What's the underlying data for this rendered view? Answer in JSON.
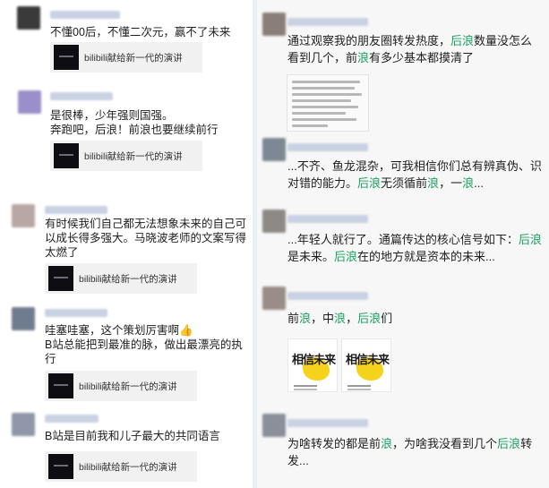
{
  "left_comments": [
    {
      "text": "不懂00后，不懂二次元，赢不了未来",
      "card": "bilibili献给新一代的演讲",
      "avatar_color": "#3a3a3a"
    },
    {
      "text": "是很棒，少年强则国强。\n奔跑吧，后浪！前浪也要继续前行",
      "card": "bilibili献给新一代的演讲",
      "avatar_color": "#9a8fc8"
    },
    {
      "text": "有时候我们自己都无法想象未来的自己可以成长得多强大。马晓波老师的文案写得太燃了",
      "card": "bilibili献给新一代的演讲",
      "avatar_color": "#b9a7a6"
    },
    {
      "text": "哇塞哇塞，这个策划厉害啊👍\nB站总能把到最准的脉，做出最漂亮的执行",
      "card": "bilibili献给新一代的演讲",
      "avatar_color": "#6f7c8f"
    },
    {
      "text": "B站是目前我和儿子最大的共同语言",
      "card": "bilibili献给新一代的演讲",
      "avatar_color": "#8e96a8"
    }
  ],
  "right_posts": [
    {
      "text": "通过观察我的朋友圈转发热度，后浪数量没怎么看到几个，前浪有多少基本都摸清了",
      "highlights": [
        "后浪",
        "浪"
      ],
      "avatar_color": "#8a7e78"
    },
    {
      "text": "...不齐、鱼龙混杂，可我相信你们总有辨真伪、识对错的能力。后浪无须循前浪，一浪...",
      "highlights": [
        "后浪",
        "浪"
      ],
      "avatar_color": "#7d8894"
    },
    {
      "text": "...年轻人就行了。通篇传达的核心信号如下：后浪是未来。后浪在的地方就是资本的未来...",
      "highlights": [
        "后浪"
      ],
      "avatar_color": "#8d8a85"
    },
    {
      "text": "前浪，中浪，后浪们",
      "highlights": [
        "浪"
      ],
      "avatar_color": "#9a8c86"
    },
    {
      "text": "为啥转发的都是前浪，为啥我没看到几个后浪转发...",
      "highlights": [
        "浪"
      ],
      "avatar_color": "#8a8f9a"
    }
  ],
  "poster": {
    "word": "相信未来"
  },
  "colors": {
    "highlight": "#1aa260",
    "card_bg": "#f1f1f1",
    "divider": "#eceff3"
  }
}
